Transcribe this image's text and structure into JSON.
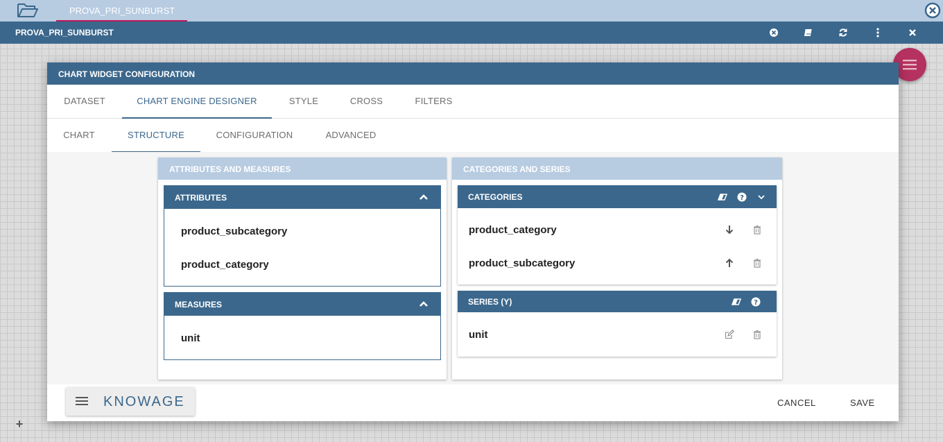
{
  "document_tab": {
    "label": "PROVA_PRI_SUNBURST"
  },
  "header": {
    "title": "PROVA_PRI_SUNBURST",
    "icons": [
      "close-circle-icon",
      "book-icon",
      "refresh-icon",
      "more-vert-icon",
      "close-icon"
    ]
  },
  "dialog": {
    "title": "CHART WIDGET CONFIGURATION",
    "tabs": [
      "DATASET",
      "CHART ENGINE DESIGNER",
      "STYLE",
      "CROSS",
      "FILTERS"
    ],
    "active_tab": "CHART ENGINE DESIGNER",
    "subtabs": [
      "CHART",
      "STRUCTURE",
      "CONFIGURATION",
      "ADVANCED"
    ],
    "active_subtab": "STRUCTURE"
  },
  "left_panel": {
    "title": "ATTRIBUTES AND MEASURES",
    "attributes": {
      "title": "ATTRIBUTES",
      "items": [
        "product_subcategory",
        "product_category"
      ]
    },
    "measures": {
      "title": "MEASURES",
      "items": [
        "unit"
      ]
    }
  },
  "right_panel": {
    "title": "CATEGORIES AND SERIES",
    "categories": {
      "title": "CATEGORIES",
      "items": [
        "product_category",
        "product_subcategory"
      ]
    },
    "series": {
      "title": "SERIES (Y)",
      "items": [
        "unit"
      ]
    }
  },
  "footer": {
    "brand": "KNOWAGE",
    "cancel_label": "CANCEL",
    "save_label": "SAVE"
  },
  "colors": {
    "primary": "#3b678c",
    "light_primary": "#b7cbe1",
    "accent": "#b5315f"
  }
}
